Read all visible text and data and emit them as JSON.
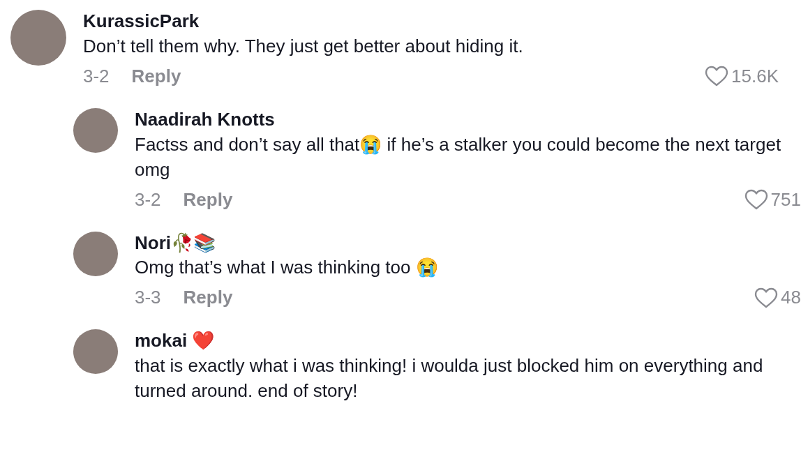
{
  "comments": [
    {
      "username": "KurassicPark",
      "text": "Don’t tell them why. They just get better about hiding it.",
      "date": "3-2",
      "reply_label": "Reply",
      "likes": "15.6K",
      "replies": [
        {
          "username": "Naadirah Knotts",
          "text": "Factss and don’t say all that😭 if he’s a stalker you could become the next target omg",
          "date": "3-2",
          "reply_label": "Reply",
          "likes": "751"
        },
        {
          "username": "Nori🥀📚",
          "text": "Omg that’s what I was thinking too 😭",
          "date": "3-3",
          "reply_label": "Reply",
          "likes": "48"
        },
        {
          "username": "mokai ❤️",
          "text": "that is exactly what i was thinking! i woulda just blocked him on everything and turned around. end of story!"
        }
      ]
    }
  ]
}
